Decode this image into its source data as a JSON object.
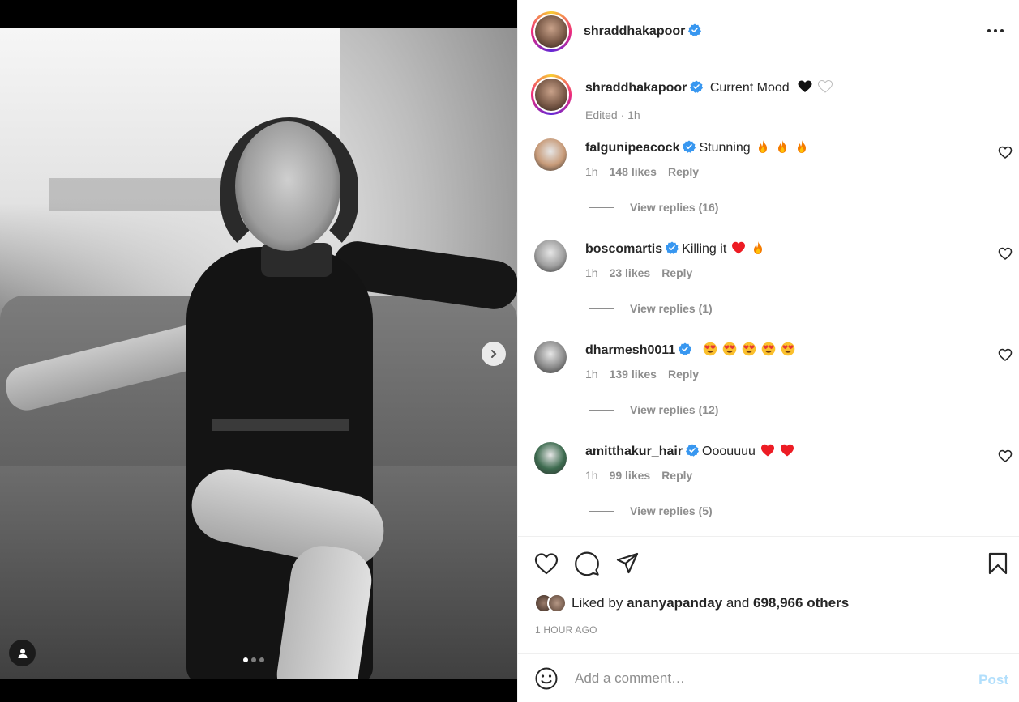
{
  "post": {
    "username": "shraddhakapoor",
    "more_label": "…",
    "caption_text": "Current Mood",
    "caption_meta": "Edited · 1h",
    "liked_by_prefix": "Liked by",
    "liked_by_user": "ananyapanday",
    "liked_by_and": "and",
    "liked_by_others": "698,966 others",
    "time_ago": "1 HOUR AGO",
    "carousel": {
      "count": 3,
      "active": 0
    }
  },
  "comments": [
    {
      "username": "falgunipeacock",
      "text": "Stunning",
      "emoji": [
        "fire",
        "fire",
        "fire"
      ],
      "time": "1h",
      "likes": "148 likes",
      "reply": "Reply",
      "view_replies": "View replies (16)",
      "avatar_color": "#c79a78"
    },
    {
      "username": "boscomartis",
      "text": "Killing it",
      "emoji": [
        "red-heart",
        "fire"
      ],
      "time": "1h",
      "likes": "23 likes",
      "reply": "Reply",
      "view_replies": "View replies (1)",
      "avatar_color": "#9e9e9e"
    },
    {
      "username": "dharmesh0011",
      "text": "",
      "emoji": [
        "heart-eyes",
        "heart-eyes",
        "heart-eyes",
        "heart-eyes",
        "heart-eyes"
      ],
      "time": "1h",
      "likes": "139 likes",
      "reply": "Reply",
      "view_replies": "View replies (12)",
      "avatar_color": "#8a8a8a"
    },
    {
      "username": "amitthakur_hair",
      "text": "Ooouuuu",
      "emoji": [
        "red-heart",
        "red-heart"
      ],
      "time": "1h",
      "likes": "99 likes",
      "reply": "Reply",
      "view_replies": "View replies (5)",
      "avatar_color": "#3d6b4f"
    }
  ],
  "composer": {
    "placeholder": "Add a comment…",
    "post_label": "Post"
  },
  "colors": {
    "verified": "#3897f0",
    "muted": "#8e8e8e",
    "post_disabled": "#b2dffc",
    "fire": "#f57c00",
    "heart_red": "#ed1c24"
  },
  "icons": [
    "chevron-right-icon",
    "user-tag-icon",
    "verified-badge-icon",
    "more-icon",
    "heart-icon",
    "comment-icon",
    "share-icon",
    "bookmark-icon",
    "emoji-icon"
  ]
}
